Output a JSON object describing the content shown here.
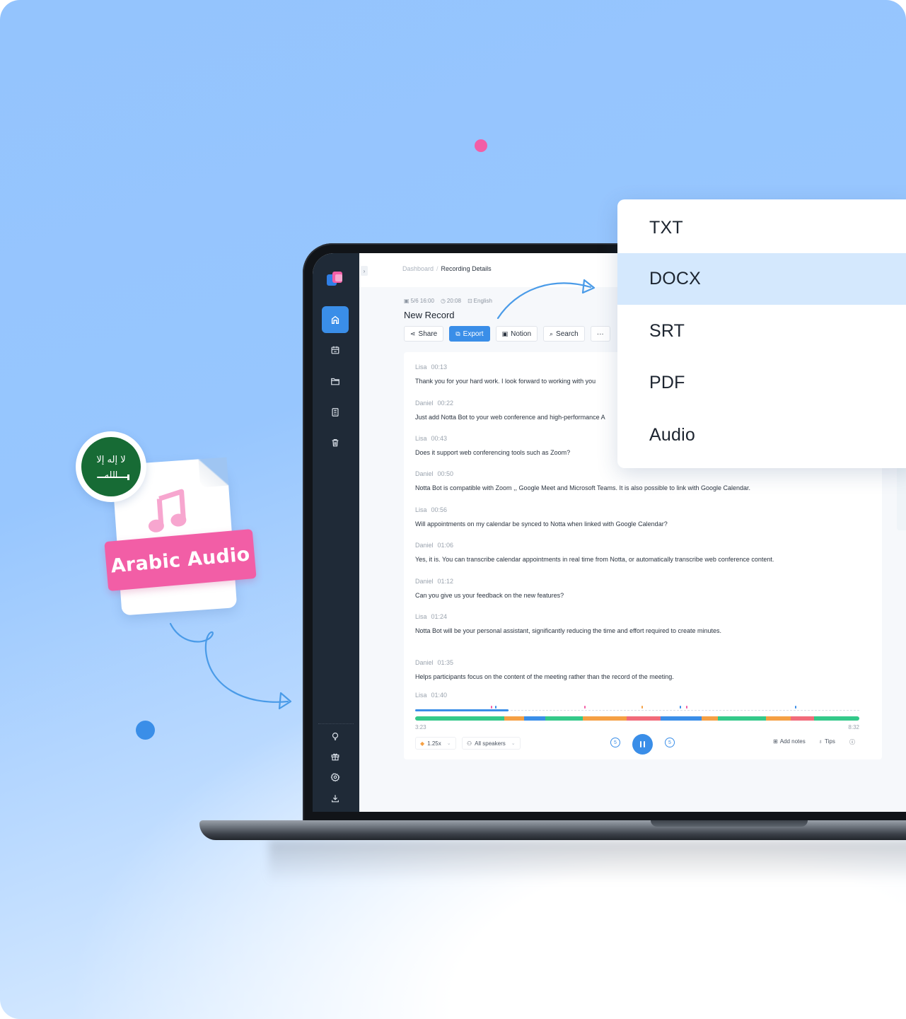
{
  "app": {
    "breadcrumb": {
      "parent": "Dashboard",
      "separator": "/",
      "current": "Recording Details"
    },
    "collapse_icon": "chevron-right-icon",
    "sidebar": {
      "top_items": [
        {
          "name": "home",
          "icon": "home-icon",
          "active": true
        },
        {
          "name": "calendar",
          "icon": "calendar-icon",
          "active": false
        },
        {
          "name": "folder",
          "icon": "folder-icon",
          "active": false
        },
        {
          "name": "document",
          "icon": "document-icon",
          "active": false
        },
        {
          "name": "trash",
          "icon": "trash-icon",
          "active": false
        }
      ],
      "bottom_items": [
        {
          "name": "tips",
          "icon": "lightbulb-icon"
        },
        {
          "name": "gift",
          "icon": "gift-icon"
        },
        {
          "name": "settings",
          "icon": "gear-icon"
        },
        {
          "name": "download",
          "icon": "download-icon"
        }
      ]
    },
    "record": {
      "date": "5/6 16:00",
      "duration": "20:08",
      "language": "English",
      "title": "New Record"
    },
    "actions": {
      "share": "Share",
      "export": "Export",
      "notion": "Notion",
      "search": "Search",
      "more": "···"
    },
    "transcript": [
      {
        "speaker": "Lisa",
        "time": "00:13",
        "text": "Thank you for your hard work. I look forward to working with you"
      },
      {
        "speaker": "Daniel",
        "time": "00:22",
        "text": "Just add Notta Bot to your web conference and high-performance A"
      },
      {
        "speaker": "Lisa",
        "time": "00:43",
        "text": "Does it support web conferencing tools such as Zoom?"
      },
      {
        "speaker": "Daniel",
        "time": "00:50",
        "text": "Notta Bot is compatible with Zoom ,, Google Meet and Microsoft Teams. It is also possible to link with Google Calendar."
      },
      {
        "speaker": "Lisa",
        "time": "00:56",
        "text": "Will appointments on my calendar be synced to Notta when linked with Google Calendar?"
      },
      {
        "speaker": "Daniel",
        "time": "01:06",
        "text": "Yes, it is. You can transcribe calendar appointments in real time from Notta, or automatically transcribe web conference content."
      },
      {
        "speaker": "Daniel",
        "time": "01:12",
        "text": "Can you give us your feedback on the new features?"
      },
      {
        "speaker": "Lisa",
        "time": "01:24",
        "text": "Notta Bot will be your personal assistant, significantly reducing the time and effort required to create minutes."
      },
      {
        "speaker": "Daniel",
        "time": "01:35",
        "text": "Helps participants focus on the content of the meeting rather than the record of the meeting."
      },
      {
        "speaker": "Lisa",
        "time": "01:40",
        "text": ""
      }
    ],
    "player": {
      "current_time": "3:23",
      "total_time": "8:32",
      "progress_fraction": 0.21,
      "speed": "1.25x",
      "speakers_filter": "All speakers",
      "skip_back_seconds": "5",
      "skip_forward_seconds": "5",
      "add_notes": "Add notes",
      "tips": "Tips",
      "speaker_colors": {
        "green": "#34c98a",
        "orange": "#f5a044",
        "blue": "#3a8ee8",
        "red": "#f26b7a"
      },
      "speaker_segments": [
        {
          "color": "green",
          "fraction": 0.2
        },
        {
          "color": "orange",
          "fraction": 0.045
        },
        {
          "color": "blue",
          "fraction": 0.048
        },
        {
          "color": "green",
          "fraction": 0.085
        },
        {
          "color": "orange",
          "fraction": 0.098
        },
        {
          "color": "red",
          "fraction": 0.077
        },
        {
          "color": "blue",
          "fraction": 0.092
        },
        {
          "color": "orange",
          "fraction": 0.037
        },
        {
          "color": "green",
          "fraction": 0.108
        },
        {
          "color": "orange",
          "fraction": 0.055
        },
        {
          "color": "red",
          "fraction": 0.053
        },
        {
          "color": "green",
          "fraction": 0.102
        }
      ],
      "markers": [
        {
          "position": 0.17,
          "color": "#f25ea6"
        },
        {
          "position": 0.18,
          "color": "#3a8ee8"
        },
        {
          "position": 0.38,
          "color": "#f25ea6"
        },
        {
          "position": 0.51,
          "color": "#f5a044"
        },
        {
          "position": 0.595,
          "color": "#3a8ee8"
        },
        {
          "position": 0.61,
          "color": "#f25ea6"
        },
        {
          "position": 0.855,
          "color": "#3a8ee8"
        }
      ]
    }
  },
  "export_menu": {
    "items": [
      {
        "label": "TXT",
        "highlighted": false
      },
      {
        "label": "DOCX",
        "highlighted": true
      },
      {
        "label": "SRT",
        "highlighted": false
      },
      {
        "label": "PDF",
        "highlighted": false
      },
      {
        "label": "Audio",
        "highlighted": false
      }
    ]
  },
  "promo": {
    "file_label": "Arabic Audio",
    "file_icon": "music-note-icon",
    "flag": "saudi-arabia-flag-icon",
    "flag_script": "لا إله إلا الله"
  },
  "colors": {
    "accent_blue": "#3a8ee8",
    "accent_pink": "#f25ea6",
    "sidebar_dark": "#1f2a37",
    "menu_highlight": "#d4e8fd"
  }
}
